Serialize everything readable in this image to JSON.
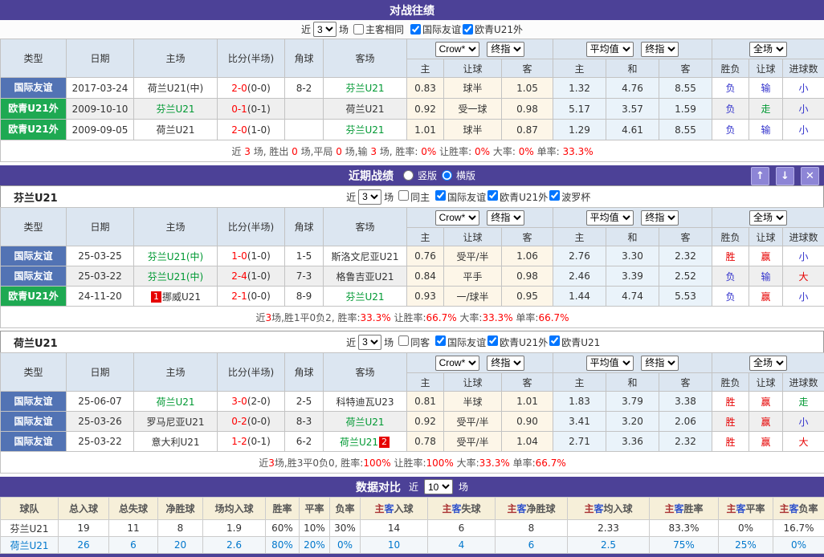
{
  "palette": {
    "purple": "#4c4197",
    "button_purple": "#8d85d6",
    "badge_blue": "#5273b4",
    "badge_green": "#1ea952",
    "team_green": "#009933",
    "score_red": "#ff0000",
    "result_blue": "#3333cc",
    "odds_bg": "#fdf6e8",
    "avg_bg": "#eaf3fa"
  },
  "labels": {
    "near": "近",
    "games": "场"
  },
  "cols": {
    "type": "类型",
    "date": "日期",
    "home": "主场",
    "score": "比分(半场)",
    "corner": "角球",
    "away": "客场",
    "h": "主",
    "handicap": "让球",
    "a": "客",
    "draw": "和",
    "wl": "胜负",
    "goals": "进球数"
  },
  "dropdowns": {
    "crow": "Crow*",
    "final": "终指",
    "avg": "平均值",
    "full": "全场"
  },
  "h2h": {
    "title": "对战往绩",
    "filter": {
      "rounds": "3",
      "cb0": {
        "label": "主客相同",
        "checked": false
      },
      "cb1": {
        "label": "国际友谊",
        "checked": true
      },
      "cb2": {
        "label": "欧青U21外",
        "checked": true
      }
    },
    "rows": [
      {
        "type": "国际友谊",
        "date": "2017-03-24",
        "home": "荷兰U21(中)",
        "score": "2-0",
        "half": "(0-0)",
        "corner": "8-2",
        "away": "芬兰U21",
        "o1": "0.83",
        "oh": "球半",
        "o2": "1.05",
        "a1": "1.32",
        "ax": "4.76",
        "a2": "8.55",
        "r1": "负",
        "r2": "输",
        "r3": "小"
      },
      {
        "type": "欧青U21外",
        "date": "2009-10-10",
        "home": "芬兰U21",
        "score": "0-1",
        "half": "(0-1)",
        "corner": "",
        "away": "荷兰U21",
        "o1": "0.92",
        "oh": "受一球",
        "o2": "0.98",
        "a1": "5.17",
        "ax": "3.57",
        "a2": "1.59",
        "r1": "负",
        "r2": "走",
        "r3": "小"
      },
      {
        "type": "欧青U21外",
        "date": "2009-09-05",
        "home": "荷兰U21",
        "score": "2-0",
        "half": "(1-0)",
        "corner": "",
        "away": "芬兰U21",
        "o1": "1.01",
        "oh": "球半",
        "o2": "0.87",
        "a1": "1.29",
        "ax": "4.61",
        "a2": "8.55",
        "r1": "负",
        "r2": "输",
        "r3": "小"
      }
    ],
    "summary": [
      {
        "t": "近 "
      },
      {
        "t": "3",
        "c": "red"
      },
      {
        "t": " 场, 胜出 "
      },
      {
        "t": "0",
        "c": "red"
      },
      {
        "t": " 场,平局 "
      },
      {
        "t": "0",
        "c": "red"
      },
      {
        "t": " 场,输 "
      },
      {
        "t": "3",
        "c": "red"
      },
      {
        "t": " 场, 胜率: "
      },
      {
        "t": "0%",
        "c": "red"
      },
      {
        "t": " 让胜率: "
      },
      {
        "t": "0%",
        "c": "red"
      },
      {
        "t": " 大率: "
      },
      {
        "t": "0%",
        "c": "red"
      },
      {
        "t": " 单率: "
      },
      {
        "t": "33.3%",
        "c": "red"
      }
    ]
  },
  "recent": {
    "title": "近期战绩",
    "radio_vertical": {
      "label": "竖版",
      "checked": false
    },
    "radio_horizontal": {
      "label": "横版",
      "checked": true
    },
    "fin": {
      "team": "芬兰U21",
      "filter": {
        "rounds": "3",
        "cb0": {
          "label": "同主",
          "checked": false
        },
        "cb1": {
          "label": "国际友谊",
          "checked": true
        },
        "cb2": {
          "label": "欧青U21外",
          "checked": true
        },
        "cb3": {
          "label": "波罗杯",
          "checked": true
        }
      },
      "rows": [
        {
          "type": "国际友谊",
          "date": "25-03-25",
          "home": "芬兰U21(中)",
          "score": "1-0",
          "half": "(1-0)",
          "corner": "1-5",
          "away": "斯洛文尼亚U21",
          "o1": "0.76",
          "oh": "受平/半",
          "o2": "1.06",
          "a1": "2.76",
          "ax": "3.30",
          "a2": "2.32",
          "r1": "胜",
          "r2": "赢",
          "r3": "小"
        },
        {
          "type": "国际友谊",
          "date": "25-03-22",
          "home": "芬兰U21(中)",
          "score": "2-4",
          "half": "(1-0)",
          "corner": "7-3",
          "away": "格鲁吉亚U21",
          "o1": "0.84",
          "oh": "平手",
          "o2": "0.98",
          "a1": "2.46",
          "ax": "3.39",
          "a2": "2.52",
          "r1": "负",
          "r2": "输",
          "r3": "大"
        },
        {
          "type": "欧青U21外",
          "date": "24-11-20",
          "home_rank": "1",
          "home": "挪威U21",
          "score": "2-1",
          "half": "(0-0)",
          "corner": "8-9",
          "away": "芬兰U21",
          "o1": "0.93",
          "oh": "一/球半",
          "o2": "0.95",
          "a1": "1.44",
          "ax": "4.74",
          "a2": "5.53",
          "r1": "负",
          "r2": "赢",
          "r3": "小"
        }
      ],
      "summary": [
        {
          "t": "近"
        },
        {
          "t": "3",
          "c": "red"
        },
        {
          "t": "场,胜1平0负2, 胜率:"
        },
        {
          "t": "33.3%",
          "c": "red"
        },
        {
          "t": " 让胜率:"
        },
        {
          "t": "66.7%",
          "c": "red"
        },
        {
          "t": " 大率:"
        },
        {
          "t": "33.3%",
          "c": "red"
        },
        {
          "t": " 单率:"
        },
        {
          "t": "66.7%",
          "c": "red"
        }
      ]
    },
    "ned": {
      "team": "荷兰U21",
      "filter": {
        "rounds": "3",
        "cb0": {
          "label": "同客",
          "checked": false
        },
        "cb1": {
          "label": "国际友谊",
          "checked": true
        },
        "cb2": {
          "label": "欧青U21外",
          "checked": true
        },
        "cb3": {
          "label": "欧青U21",
          "checked": true
        }
      },
      "rows": [
        {
          "type": "国际友谊",
          "date": "25-06-07",
          "home": "荷兰U21",
          "score": "3-0",
          "half": "(2-0)",
          "corner": "2-5",
          "away": "科特迪瓦U23",
          "o1": "0.81",
          "oh": "半球",
          "o2": "1.01",
          "a1": "1.83",
          "ax": "3.79",
          "a2": "3.38",
          "r1": "胜",
          "r2": "赢",
          "r3": "走"
        },
        {
          "type": "国际友谊",
          "date": "25-03-26",
          "home": "罗马尼亚U21",
          "score": "0-2",
          "half": "(0-0)",
          "corner": "8-3",
          "away": "荷兰U21",
          "o1": "0.92",
          "oh": "受平/半",
          "o2": "0.90",
          "a1": "3.41",
          "ax": "3.20",
          "a2": "2.06",
          "r1": "胜",
          "r2": "赢",
          "r3": "小"
        },
        {
          "type": "国际友谊",
          "date": "25-03-22",
          "home": "意大利U21",
          "score": "1-2",
          "half": "(0-1)",
          "corner": "6-2",
          "away": "荷兰U21",
          "away_rank": "2",
          "o1": "0.78",
          "oh": "受平/半",
          "o2": "1.04",
          "a1": "2.71",
          "ax": "3.36",
          "a2": "2.32",
          "r1": "胜",
          "r2": "赢",
          "r3": "大"
        }
      ],
      "summary": [
        {
          "t": "近"
        },
        {
          "t": "3",
          "c": "red"
        },
        {
          "t": "场,胜3平0负0, 胜率:"
        },
        {
          "t": "100%",
          "c": "red"
        },
        {
          "t": " 让胜率:"
        },
        {
          "t": "100%",
          "c": "red"
        },
        {
          "t": " 大率:"
        },
        {
          "t": "33.3%",
          "c": "red"
        },
        {
          "t": " 单率:"
        },
        {
          "t": "66.7%",
          "c": "red"
        }
      ]
    }
  },
  "comparison": {
    "title": "数据对比",
    "rounds": "10",
    "headers": [
      [
        {
          "t": "球队"
        }
      ],
      [
        {
          "t": "总入球"
        }
      ],
      [
        {
          "t": "总失球"
        }
      ],
      [
        {
          "t": "净胜球"
        }
      ],
      [
        {
          "t": "场均入球"
        }
      ],
      [
        {
          "t": "胜率"
        }
      ],
      [
        {
          "t": "平率"
        }
      ],
      [
        {
          "t": "负率"
        }
      ],
      [
        {
          "t": "主",
          "c": "ch"
        },
        {
          "t": "客",
          "c": "ca"
        },
        {
          "t": "入球"
        }
      ],
      [
        {
          "t": "主",
          "c": "ch"
        },
        {
          "t": "客",
          "c": "ca"
        },
        {
          "t": "失球"
        }
      ],
      [
        {
          "t": "主",
          "c": "ch"
        },
        {
          "t": "客",
          "c": "ca"
        },
        {
          "t": "净胜球"
        }
      ],
      [
        {
          "t": "主",
          "c": "ch"
        },
        {
          "t": "客",
          "c": "ca"
        },
        {
          "t": "均入球"
        }
      ],
      [
        {
          "t": "主",
          "c": "ch"
        },
        {
          "t": "客",
          "c": "ca"
        },
        {
          "t": "胜率"
        }
      ],
      [
        {
          "t": "主",
          "c": "ch"
        },
        {
          "t": "客",
          "c": "ca"
        },
        {
          "t": "平率"
        }
      ],
      [
        {
          "t": "主",
          "c": "ch"
        },
        {
          "t": "客",
          "c": "ca"
        },
        {
          "t": "负率"
        }
      ]
    ],
    "rows": [
      [
        "芬兰U21",
        "19",
        "11",
        "8",
        "1.9",
        "60%",
        "10%",
        "30%",
        "14",
        "6",
        "8",
        "2.33",
        "83.3%",
        "0%",
        "16.7%"
      ],
      [
        "荷兰U21",
        "26",
        "6",
        "20",
        "2.6",
        "80%",
        "20%",
        "0%",
        "10",
        "4",
        "6",
        "2.5",
        "75%",
        "25%",
        "0%"
      ]
    ]
  }
}
